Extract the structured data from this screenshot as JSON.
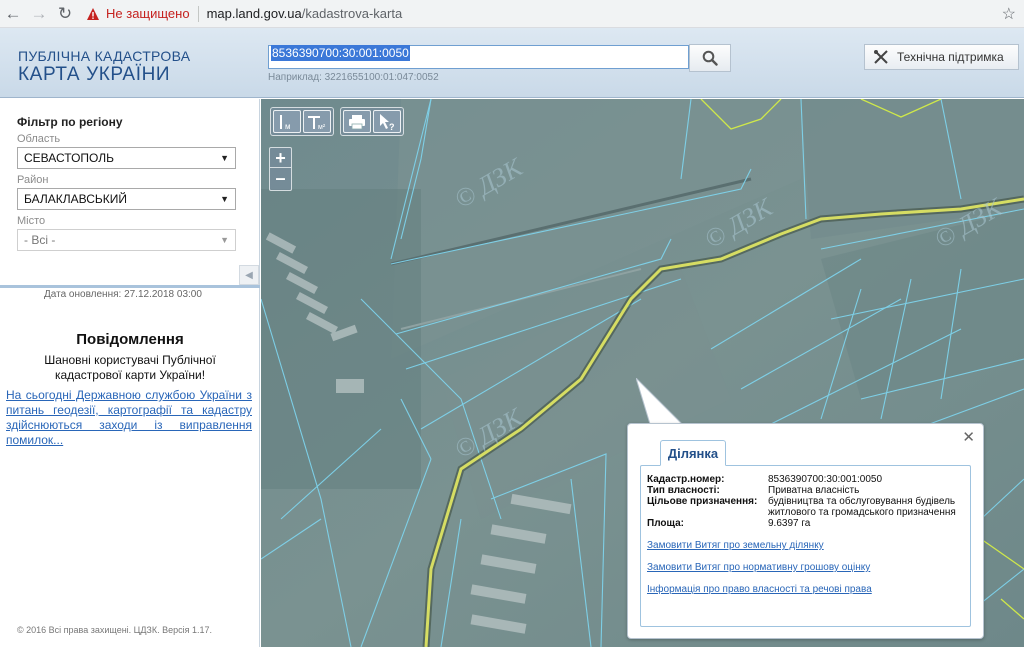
{
  "browser": {
    "back_icon": "arrow-left-icon",
    "forward_icon": "arrow-right-icon",
    "reload_icon": "reload-icon",
    "security_text": "Не защищено",
    "url_host": "map.land.gov.ua",
    "url_path": "/kadastrova-karta"
  },
  "header": {
    "logo_line1": "ПУБЛІЧНА КАДАСТРОВА",
    "logo_line2": "КАРТА УКРАЇНИ",
    "search_value": "8536390700:30:001:0050",
    "search_hint": "Наприклад: 3221655100:01:047:0052",
    "support_label": "Технічна підтримка"
  },
  "sidebar": {
    "filter_title": "Фільтр по регіону",
    "region_label": "Область",
    "region_value": "СЕВАСТОПОЛЬ",
    "district_label": "Район",
    "district_value": "БАЛАКЛАВСЬКИЙ",
    "city_label": "Місто",
    "city_value": "- Всі -",
    "update_date": "Дата оновлення: 27.12.2018 03:00",
    "notice_title": "Повідомлення",
    "notice_greeting": "Шановні користувачі Публічної кадастрової карти України!",
    "notice_link": "На сьогодні Державною службою України з питань геодезії, картографії та кадастру здійснюються заходи із виправлення помилок...",
    "copyright": "© 2016 Всі права захищені. ЦДЗК. Версія 1.17."
  },
  "map": {
    "tools": {
      "measure_length": "м",
      "measure_area": "м²"
    },
    "watermark": "ДЗК"
  },
  "popup": {
    "tab_label": "Ділянка",
    "rows": [
      {
        "label": "Кадастр.номер:",
        "value": "8536390700:30:001:0050"
      },
      {
        "label": "Тип власності:",
        "value": "Приватна власність"
      },
      {
        "label": "Цільове призначення:",
        "value": "будівництва та обслуговування будівель житлового та громадського призначення"
      },
      {
        "label": "Площа:",
        "value": "9.6397 га"
      }
    ],
    "links": [
      "Замовити Витяг про земельну ділянку",
      "Замовити Витяг про нормативну грошову оцінку",
      "Інформація про право власності та речові права"
    ]
  },
  "colors": {
    "header_text": "#23508a",
    "link": "#2966b8",
    "road": "#d6dd63",
    "parcel_lines": "#7fd6f0",
    "selected_parcel": "#cfe84a"
  }
}
